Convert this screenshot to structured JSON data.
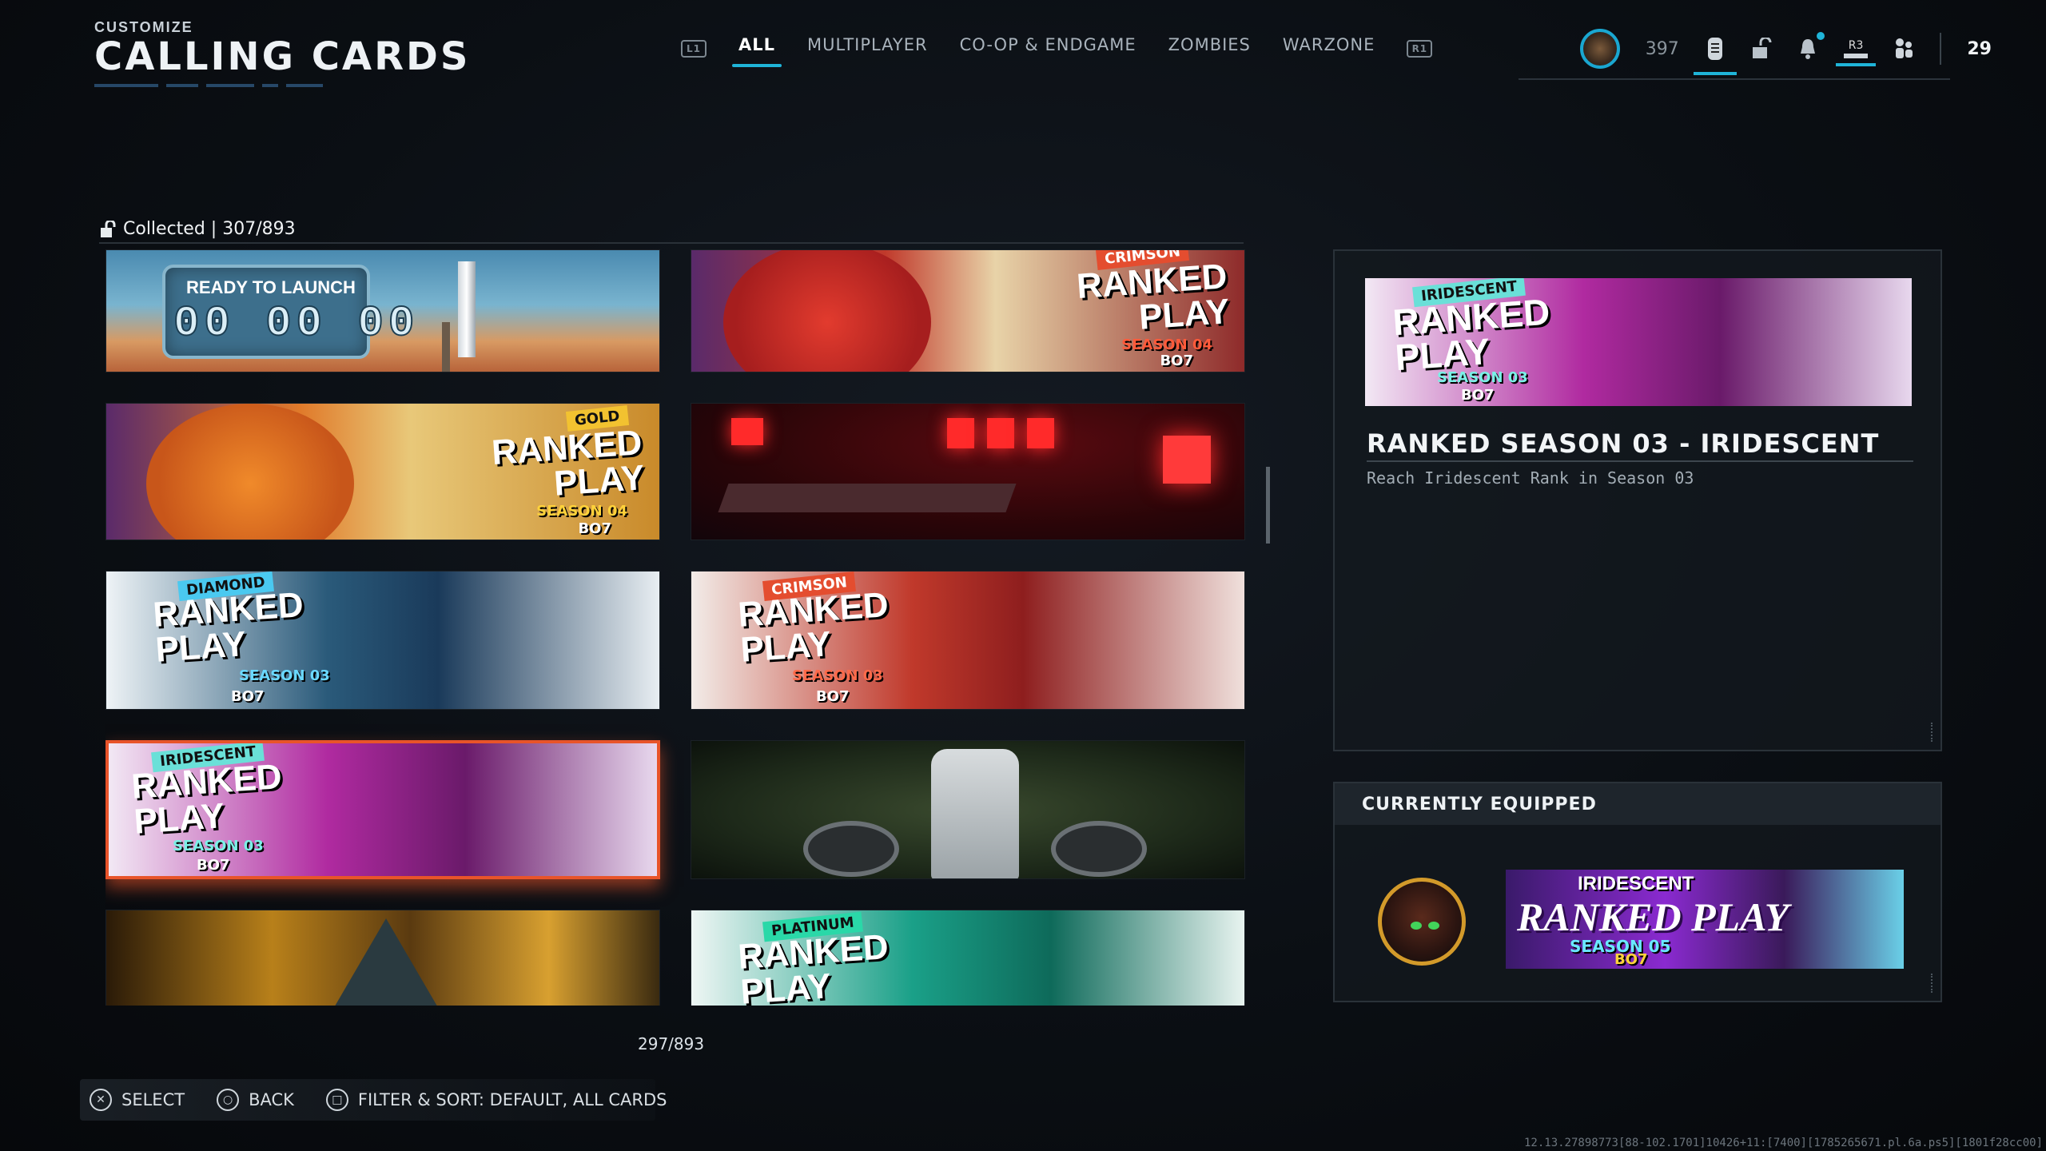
{
  "header": {
    "eyebrow": "CUSTOMIZE",
    "title": "CALLING CARDS"
  },
  "nav": {
    "left_bumper": "L1",
    "right_bumper": "R1",
    "tabs": [
      {
        "label": "ALL",
        "active": true
      },
      {
        "label": "MULTIPLAYER",
        "active": false
      },
      {
        "label": "CO-OP & ENDGAME",
        "active": false
      },
      {
        "label": "ZOMBIES",
        "active": false
      },
      {
        "label": "WARZONE",
        "active": false
      }
    ]
  },
  "status": {
    "currency": "397",
    "r3_label": "R3",
    "count": "29"
  },
  "collection": {
    "collected_label": "Collected | 307/893",
    "counter": "297/893"
  },
  "cards": [
    {
      "title": "READY TO LAUNCH",
      "timer": "00 00 00"
    },
    {
      "tag": "CRIMSON",
      "title": "RANKED PLAY",
      "season": "SEASON 04",
      "game": "BO7"
    },
    {
      "tag": "GOLD",
      "title": "RANKED PLAY",
      "season": "SEASON 04",
      "game": "BO7"
    },
    {
      "title": ""
    },
    {
      "tag": "DIAMOND",
      "title": "RANKED PLAY",
      "season": "SEASON 03",
      "game": "BO7"
    },
    {
      "tag": "CRIMSON",
      "title": "RANKED PLAY",
      "season": "SEASON 03",
      "game": "BO7"
    },
    {
      "tag": "IRIDESCENT",
      "title": "RANKED PLAY",
      "season": "SEASON 03",
      "game": "BO7",
      "selected": true
    },
    {
      "title": ""
    },
    {
      "title": ""
    },
    {
      "tag": "PLATINUM",
      "title": "RANKED PLAY"
    }
  ],
  "detail": {
    "preview_tag": "IRIDESCENT",
    "preview_title": "RANKED PLAY",
    "preview_season": "SEASON 03",
    "preview_game": "BO7",
    "name": "RANKED SEASON 03 - IRIDESCENT",
    "description": "Reach Iridescent Rank in Season 03"
  },
  "equipped": {
    "header": "CURRENTLY EQUIPPED",
    "card_tag": "IRIDESCENT",
    "card_title": "RANKED PLAY",
    "card_season": "SEASON 05",
    "card_game": "BO7"
  },
  "footer": {
    "select": "SELECT",
    "back": "BACK",
    "filter": "FILTER & SORT: DEFAULT, ALL CARDS"
  },
  "build_info": "12.13.27898773[88-102.1701]10426+11:[7400][1785265671.pl.6a.ps5][1801f28cc00]",
  "colors": {
    "accent": "#1fb4d8",
    "selected": "#e8542a"
  }
}
